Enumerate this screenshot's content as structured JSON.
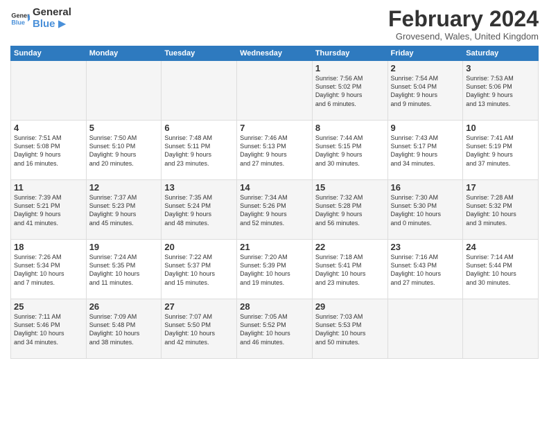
{
  "logo": {
    "line1": "General",
    "line2": "Blue",
    "arrow_color": "#4a90d9"
  },
  "title": "February 2024",
  "location": "Grovesend, Wales, United Kingdom",
  "header_days": [
    "Sunday",
    "Monday",
    "Tuesday",
    "Wednesday",
    "Thursday",
    "Friday",
    "Saturday"
  ],
  "weeks": [
    [
      {
        "day": "",
        "info": ""
      },
      {
        "day": "",
        "info": ""
      },
      {
        "day": "",
        "info": ""
      },
      {
        "day": "",
        "info": ""
      },
      {
        "day": "1",
        "info": "Sunrise: 7:56 AM\nSunset: 5:02 PM\nDaylight: 9 hours\nand 6 minutes."
      },
      {
        "day": "2",
        "info": "Sunrise: 7:54 AM\nSunset: 5:04 PM\nDaylight: 9 hours\nand 9 minutes."
      },
      {
        "day": "3",
        "info": "Sunrise: 7:53 AM\nSunset: 5:06 PM\nDaylight: 9 hours\nand 13 minutes."
      }
    ],
    [
      {
        "day": "4",
        "info": "Sunrise: 7:51 AM\nSunset: 5:08 PM\nDaylight: 9 hours\nand 16 minutes."
      },
      {
        "day": "5",
        "info": "Sunrise: 7:50 AM\nSunset: 5:10 PM\nDaylight: 9 hours\nand 20 minutes."
      },
      {
        "day": "6",
        "info": "Sunrise: 7:48 AM\nSunset: 5:11 PM\nDaylight: 9 hours\nand 23 minutes."
      },
      {
        "day": "7",
        "info": "Sunrise: 7:46 AM\nSunset: 5:13 PM\nDaylight: 9 hours\nand 27 minutes."
      },
      {
        "day": "8",
        "info": "Sunrise: 7:44 AM\nSunset: 5:15 PM\nDaylight: 9 hours\nand 30 minutes."
      },
      {
        "day": "9",
        "info": "Sunrise: 7:43 AM\nSunset: 5:17 PM\nDaylight: 9 hours\nand 34 minutes."
      },
      {
        "day": "10",
        "info": "Sunrise: 7:41 AM\nSunset: 5:19 PM\nDaylight: 9 hours\nand 37 minutes."
      }
    ],
    [
      {
        "day": "11",
        "info": "Sunrise: 7:39 AM\nSunset: 5:21 PM\nDaylight: 9 hours\nand 41 minutes."
      },
      {
        "day": "12",
        "info": "Sunrise: 7:37 AM\nSunset: 5:23 PM\nDaylight: 9 hours\nand 45 minutes."
      },
      {
        "day": "13",
        "info": "Sunrise: 7:35 AM\nSunset: 5:24 PM\nDaylight: 9 hours\nand 48 minutes."
      },
      {
        "day": "14",
        "info": "Sunrise: 7:34 AM\nSunset: 5:26 PM\nDaylight: 9 hours\nand 52 minutes."
      },
      {
        "day": "15",
        "info": "Sunrise: 7:32 AM\nSunset: 5:28 PM\nDaylight: 9 hours\nand 56 minutes."
      },
      {
        "day": "16",
        "info": "Sunrise: 7:30 AM\nSunset: 5:30 PM\nDaylight: 10 hours\nand 0 minutes."
      },
      {
        "day": "17",
        "info": "Sunrise: 7:28 AM\nSunset: 5:32 PM\nDaylight: 10 hours\nand 3 minutes."
      }
    ],
    [
      {
        "day": "18",
        "info": "Sunrise: 7:26 AM\nSunset: 5:34 PM\nDaylight: 10 hours\nand 7 minutes."
      },
      {
        "day": "19",
        "info": "Sunrise: 7:24 AM\nSunset: 5:35 PM\nDaylight: 10 hours\nand 11 minutes."
      },
      {
        "day": "20",
        "info": "Sunrise: 7:22 AM\nSunset: 5:37 PM\nDaylight: 10 hours\nand 15 minutes."
      },
      {
        "day": "21",
        "info": "Sunrise: 7:20 AM\nSunset: 5:39 PM\nDaylight: 10 hours\nand 19 minutes."
      },
      {
        "day": "22",
        "info": "Sunrise: 7:18 AM\nSunset: 5:41 PM\nDaylight: 10 hours\nand 23 minutes."
      },
      {
        "day": "23",
        "info": "Sunrise: 7:16 AM\nSunset: 5:43 PM\nDaylight: 10 hours\nand 27 minutes."
      },
      {
        "day": "24",
        "info": "Sunrise: 7:14 AM\nSunset: 5:44 PM\nDaylight: 10 hours\nand 30 minutes."
      }
    ],
    [
      {
        "day": "25",
        "info": "Sunrise: 7:11 AM\nSunset: 5:46 PM\nDaylight: 10 hours\nand 34 minutes."
      },
      {
        "day": "26",
        "info": "Sunrise: 7:09 AM\nSunset: 5:48 PM\nDaylight: 10 hours\nand 38 minutes."
      },
      {
        "day": "27",
        "info": "Sunrise: 7:07 AM\nSunset: 5:50 PM\nDaylight: 10 hours\nand 42 minutes."
      },
      {
        "day": "28",
        "info": "Sunrise: 7:05 AM\nSunset: 5:52 PM\nDaylight: 10 hours\nand 46 minutes."
      },
      {
        "day": "29",
        "info": "Sunrise: 7:03 AM\nSunset: 5:53 PM\nDaylight: 10 hours\nand 50 minutes."
      },
      {
        "day": "",
        "info": ""
      },
      {
        "day": "",
        "info": ""
      }
    ]
  ]
}
